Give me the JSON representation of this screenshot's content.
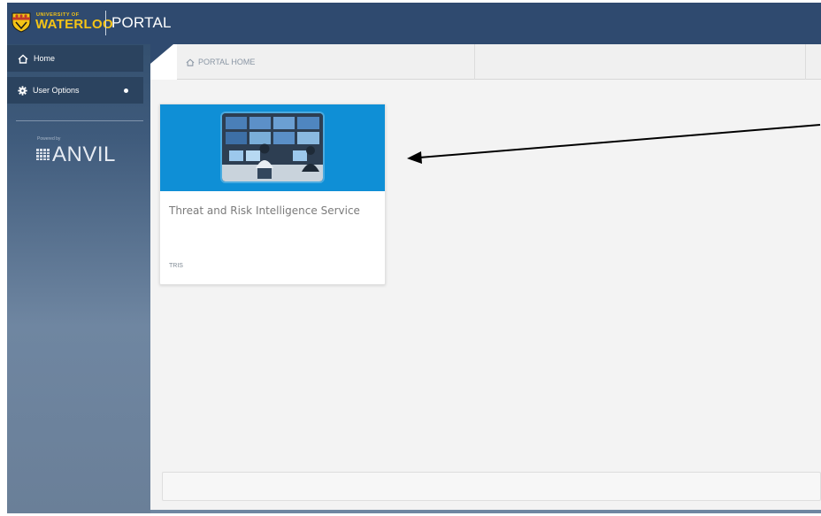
{
  "header": {
    "logo_university": "UNIVERSITY OF",
    "logo_name": "WATERLOO",
    "app_title": "PORTAL"
  },
  "sidebar": {
    "items": [
      {
        "label": "Home",
        "icon": "home-icon"
      },
      {
        "label": "User Options",
        "icon": "gear-icon"
      }
    ],
    "powered_by": "Powered by",
    "brand": "ANVIL"
  },
  "breadcrumb": {
    "label": "PORTAL HOME",
    "icon": "home-icon"
  },
  "cards": [
    {
      "title": "Threat and Risk Intelligence Service",
      "code": "TRIS",
      "header_color": "#0f8fd6"
    }
  ],
  "colors": {
    "topbar": "#2f4a6f",
    "sidebar_button": "#2b435f",
    "logo_gold": "#f5c416",
    "arrow": "#000000"
  }
}
